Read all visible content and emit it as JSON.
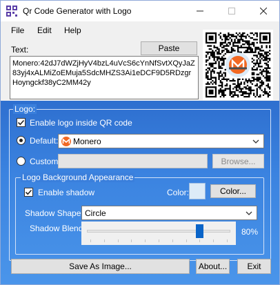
{
  "window": {
    "title": "Qr Code Generator with Logo"
  },
  "menu": [
    "File",
    "Edit",
    "Help"
  ],
  "text_section": {
    "label": "Text:",
    "paste_button": "Paste",
    "content": "Monero:42dJ7dWZjHyV4bzL4uVcS6cYnNfSvtXQyJaZ83yj4xALMiZoEMuja5SdcMHZS3Ai1eDCF9D5RDzgrHoyngckf38yC2MM42y"
  },
  "logo_group": {
    "title": "Logo:",
    "enable_logo_label": "Enable logo inside QR code",
    "enable_logo_checked": true,
    "default_label": "Default:",
    "default_selected": true,
    "default_value": "Monero",
    "custom_label": "Custom:",
    "browse_button": "Browse..."
  },
  "bg_group": {
    "title": "Logo Background Appearance",
    "enable_shadow_label": "Enable shadow",
    "enable_shadow_checked": true,
    "color_label": "Color:",
    "color_button": "Color...",
    "shadow_color": "#ddebf7",
    "shadow_shape_label": "Shadow Shape:",
    "shadow_shape_value": "Circle",
    "shadow_blend_label": "Shadow Blend",
    "shadow_blend_value": 80,
    "shadow_blend_text": "80%"
  },
  "buttons": {
    "save": "Save As Image...",
    "about": "About...",
    "exit": "Exit"
  },
  "colors": {
    "panel_top": "#2e6fcf",
    "panel_bottom": "#4a95ea",
    "monero_orange": "#f26822",
    "slider_thumb": "#0a64c8"
  },
  "icons": {
    "app": "qr-code-icon",
    "monero": "monero-logo-icon"
  }
}
